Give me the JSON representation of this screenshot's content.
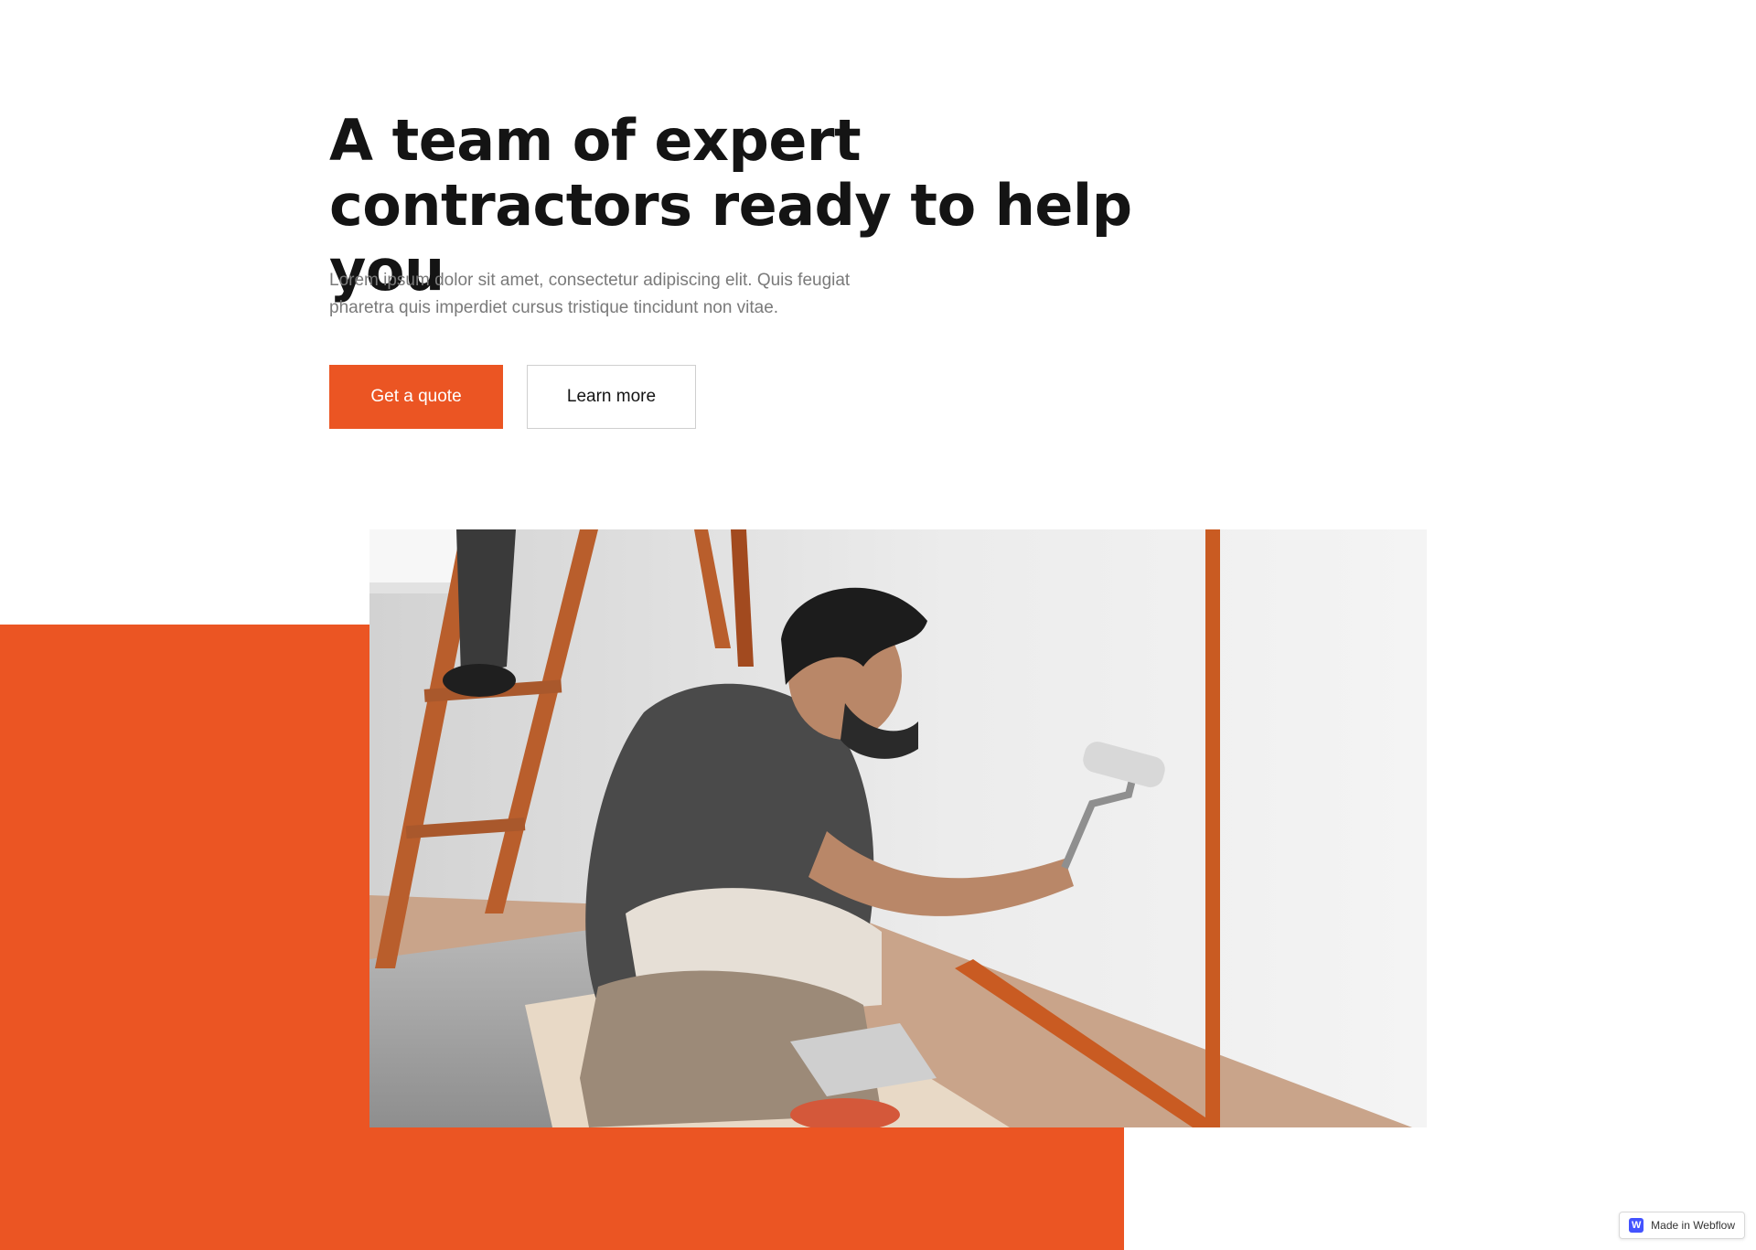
{
  "hero": {
    "title": "A team of expert contractors ready to help you",
    "subtitle": "Lorem ipsum dolor sit amet, consectetur adipiscing elit. Quis feugiat pharetra quis imperdiet cursus tristique tincidunt non vitae.",
    "primary_button": "Get a quote",
    "secondary_button": "Learn more"
  },
  "image": {
    "alt_subject": "painter-rolling-wall"
  },
  "badge": {
    "logo_letter": "W",
    "label": "Made in Webflow"
  },
  "colors": {
    "accent": "#eb5523",
    "heading": "#141414",
    "body_text": "#7a7a7a",
    "background": "#ffffff"
  }
}
